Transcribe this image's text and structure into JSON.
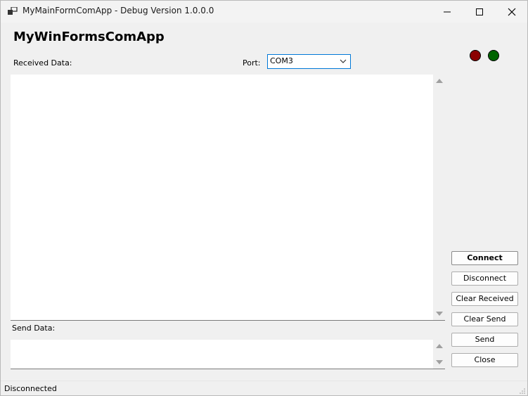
{
  "window": {
    "title": "MyMainFormComApp - Debug Version 1.0.0.0"
  },
  "header": {
    "title": "MyWinFormsComApp"
  },
  "received": {
    "label": "Received Data:",
    "text": ""
  },
  "port": {
    "label": "Port:",
    "selected": "COM3"
  },
  "send": {
    "label": "Send Data:",
    "text": ""
  },
  "indicators": {
    "red_color": "#8b0000",
    "green_color": "#006400"
  },
  "buttons": {
    "connect": "Connect",
    "disconnect": "Disconnect",
    "clear_received": "Clear Received",
    "clear_send": "Clear Send",
    "send": "Send",
    "close": "Close"
  },
  "status": {
    "text": "Disconnected"
  }
}
